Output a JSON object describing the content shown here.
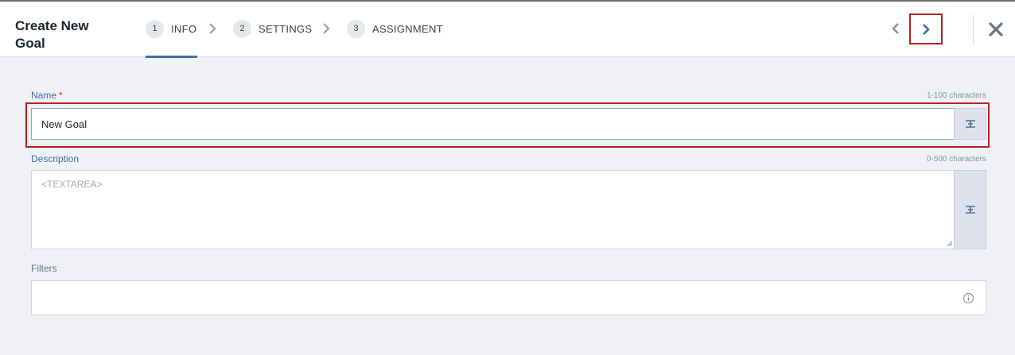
{
  "header": {
    "title": "Create New Goal",
    "steps": [
      {
        "number": "1",
        "label": "INFO"
      },
      {
        "number": "2",
        "label": "SETTINGS"
      },
      {
        "number": "3",
        "label": "ASSIGNMENT"
      }
    ],
    "active_step": 1,
    "accent": "#3d6ea6"
  },
  "form": {
    "name": {
      "label": "Name",
      "required_marker": "*",
      "hint": "1-100 characters",
      "value": "New Goal"
    },
    "description": {
      "label": "Description",
      "hint": "0-500 characters",
      "placeholder": "<TEXTAREA>"
    },
    "filters": {
      "label": "Filters"
    }
  },
  "icons": {
    "prev": "chevron-left-icon",
    "next": "chevron-right-icon",
    "close": "close-icon",
    "translate": "translate-icon",
    "info": "info-icon"
  }
}
